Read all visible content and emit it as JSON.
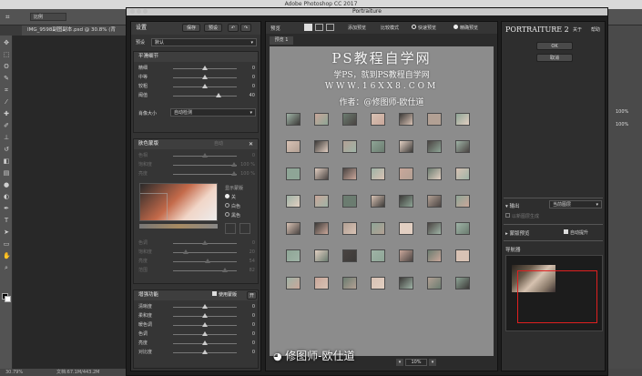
{
  "app_title": "Adobe Photoshop CC 2017",
  "options_bar": {
    "mode": "比例"
  },
  "doc_tab": "IMG_9598副图副本.psd @ 30.8% (背",
  "status": {
    "zoom": "30.79%",
    "doc": "文档:67.1M/443.2M"
  },
  "right_dock": {
    "zoom1": "100%",
    "zoom2": "100%"
  },
  "dialog": {
    "title": "Portraiture",
    "left": {
      "settings": "设置",
      "save": "保存",
      "preset": "预设",
      "preset_label": "预设",
      "preset_value": "默认",
      "smoothing": {
        "title": "平滑细节",
        "rows": [
          {
            "label": "精细",
            "value": "0",
            "pos": 0.5
          },
          {
            "label": "中等",
            "value": "0",
            "pos": 0.5
          },
          {
            "label": "较粗",
            "value": "0",
            "pos": 0.5
          },
          {
            "label": "阈值",
            "value": "40",
            "pos": 0.72
          }
        ],
        "portrait_size_label": "肖像大小",
        "portrait_size_value": "自动检测"
      },
      "skin": {
        "title": "肤色蒙版",
        "mode": "自动",
        "rows": [
          {
            "label": "色相",
            "value": "0",
            "pos": 0.5
          },
          {
            "label": "饱和度",
            "value": "100 %",
            "pos": 0.96
          },
          {
            "label": "亮度",
            "value": "100 %",
            "pos": 0.96
          }
        ],
        "display_label": "显示蒙版",
        "radios": [
          "关",
          "白色",
          "黑色"
        ],
        "rows2": [
          {
            "label": "色调",
            "value": "0",
            "pos": 0.5
          },
          {
            "label": "饱和度",
            "value": "20",
            "pos": 0.2
          },
          {
            "label": "亮度",
            "value": "54",
            "pos": 0.54
          },
          {
            "label": "范围",
            "value": "82",
            "pos": 0.82
          }
        ]
      },
      "enhance": {
        "title": "增强功能",
        "use_mask": "使用蒙版",
        "toggle": "开",
        "rows": [
          {
            "label": "清晰度",
            "value": "0",
            "pos": 0.5
          },
          {
            "label": "柔和度",
            "value": "0",
            "pos": 0.5
          },
          {
            "label": "暖色调",
            "value": "0",
            "pos": 0.5
          },
          {
            "label": "色调",
            "value": "0",
            "pos": 0.5
          },
          {
            "label": "亮度",
            "value": "0",
            "pos": 0.5
          },
          {
            "label": "对比度",
            "value": "0",
            "pos": 0.5
          }
        ]
      }
    },
    "center": {
      "preview": "预览",
      "add_preview": "添加预览",
      "compare": "比较模式",
      "quick_preview": "快速预览",
      "fine_preview": "精确预览",
      "tab": "预览 1",
      "zoom": "10%"
    },
    "right": {
      "brand": "PORTRAITURE 2",
      "about": "关于",
      "help": "帮助",
      "ok": "OK",
      "cancel": "取消",
      "output_label": "输出",
      "output_value": "当前图层",
      "new_layer": "以新图层生成",
      "mask_preview": "蒙版预览",
      "auto_enhance": "自动提升",
      "navigator": "导航器"
    }
  },
  "watermark": {
    "line1": "PS教程自学网",
    "line2": "学PS，就到PS教程自学网",
    "line3": "WWW.16XX8.COM",
    "line4": "作者：@修图师-欧仕道",
    "bottom": "修图师-欧仕道"
  },
  "colors": {
    "accent_red": "#e02020",
    "bg_dark": "#1e1e1e"
  }
}
